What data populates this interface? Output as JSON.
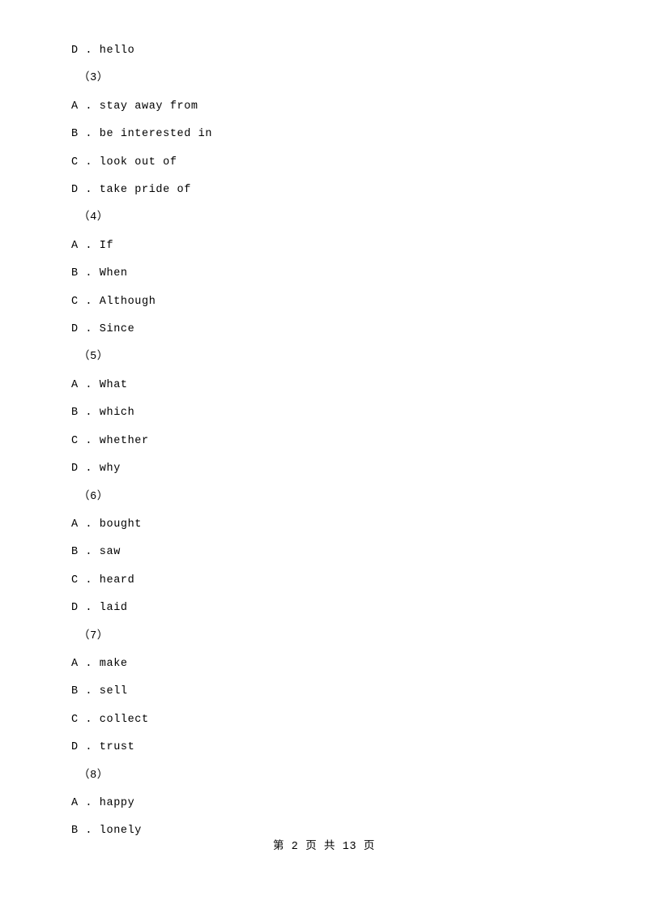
{
  "document": {
    "lines": [
      {
        "text": "D . hello",
        "type": "option"
      },
      {
        "text": "（3）",
        "type": "group"
      },
      {
        "text": "A . stay away from",
        "type": "option"
      },
      {
        "text": "B . be interested in",
        "type": "option"
      },
      {
        "text": "C . look out of",
        "type": "option"
      },
      {
        "text": "D . take pride of",
        "type": "option"
      },
      {
        "text": "（4）",
        "type": "group"
      },
      {
        "text": "A . If",
        "type": "option"
      },
      {
        "text": "B . When",
        "type": "option"
      },
      {
        "text": "C . Although",
        "type": "option"
      },
      {
        "text": "D . Since",
        "type": "option"
      },
      {
        "text": "（5）",
        "type": "group"
      },
      {
        "text": "A . What",
        "type": "option"
      },
      {
        "text": "B . which",
        "type": "option"
      },
      {
        "text": "C . whether",
        "type": "option"
      },
      {
        "text": "D . why",
        "type": "option"
      },
      {
        "text": "（6）",
        "type": "group"
      },
      {
        "text": "A . bought",
        "type": "option"
      },
      {
        "text": "B . saw",
        "type": "option"
      },
      {
        "text": "C . heard",
        "type": "option"
      },
      {
        "text": "D . laid",
        "type": "option"
      },
      {
        "text": "（7）",
        "type": "group"
      },
      {
        "text": "A . make",
        "type": "option"
      },
      {
        "text": "B . sell",
        "type": "option"
      },
      {
        "text": "C . collect",
        "type": "option"
      },
      {
        "text": "D . trust",
        "type": "option"
      },
      {
        "text": "（8）",
        "type": "group"
      },
      {
        "text": "A . happy",
        "type": "option"
      },
      {
        "text": "B . lonely",
        "type": "option"
      }
    ],
    "footer": "第 2 页 共 13 页"
  }
}
